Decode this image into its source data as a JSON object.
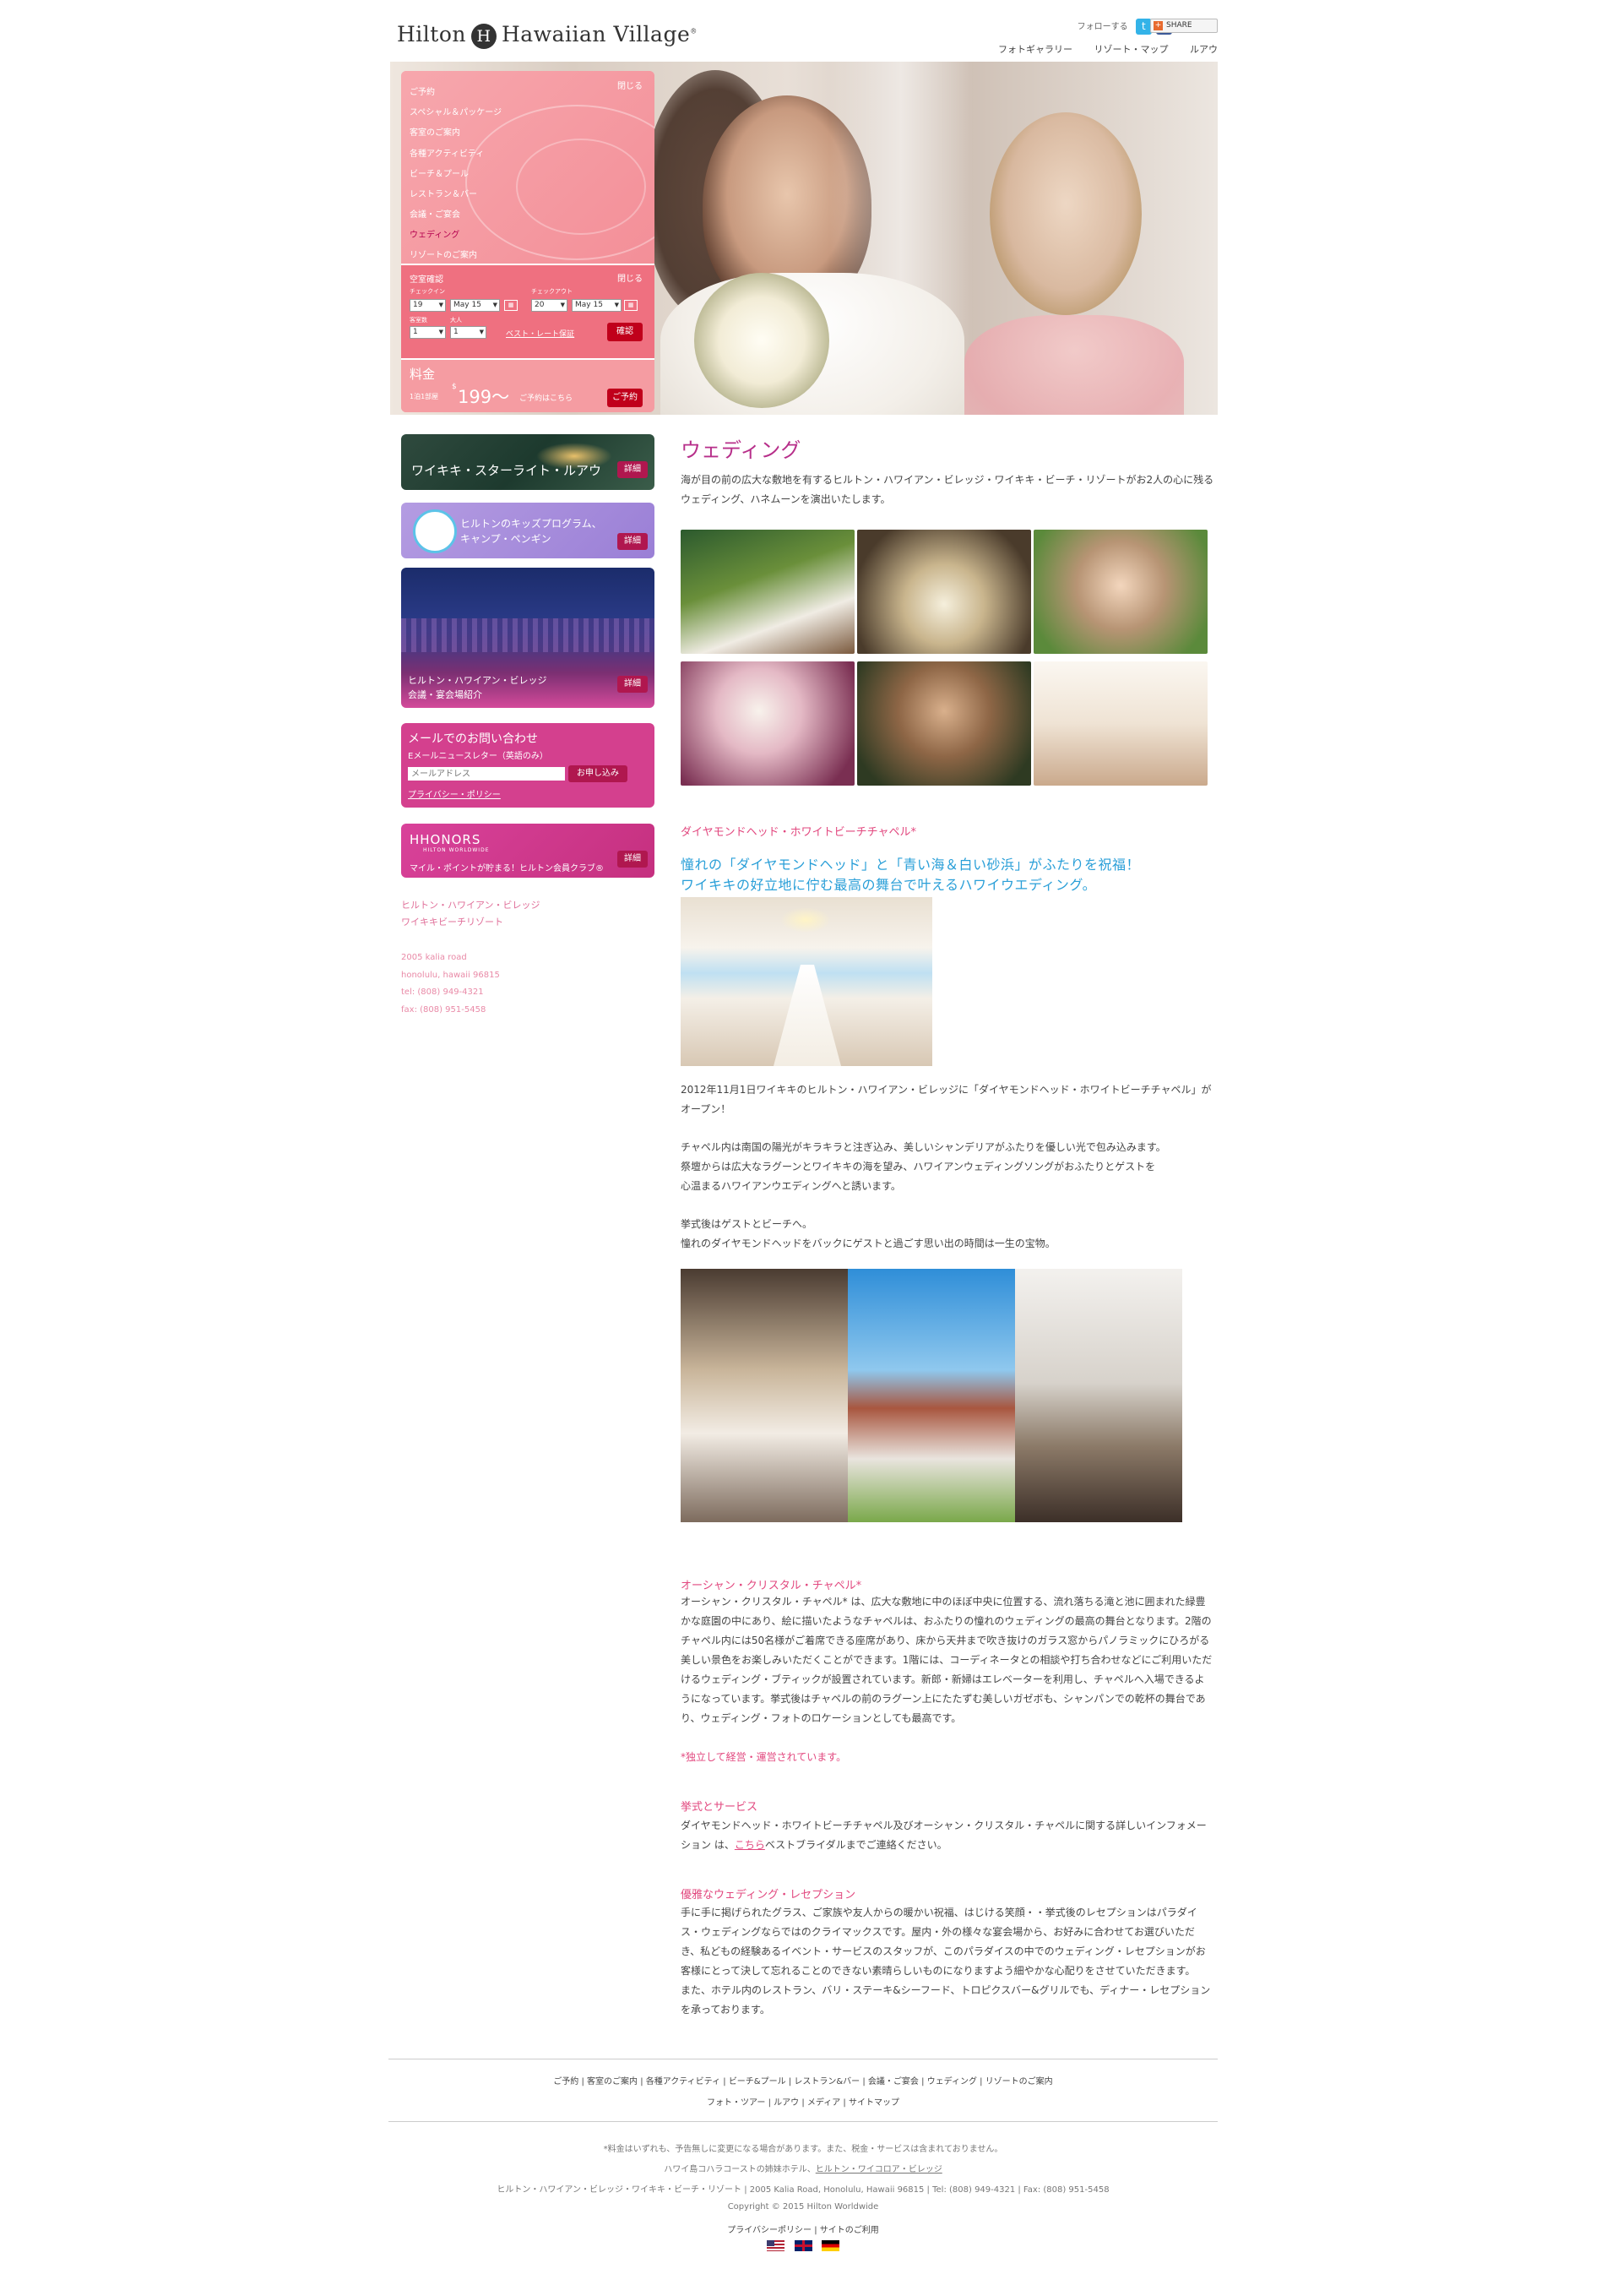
{
  "header": {
    "logo_left": "Hilton",
    "logo_mark": "H",
    "logo_right": "Hawaiian Village",
    "follow_label": "フォローする",
    "twitter_glyph": "t",
    "facebook_glyph": "f",
    "share_label": "SHARE",
    "share_glyph": "+",
    "links": [
      "フォトギャラリー",
      "リゾート・マップ",
      "ルアウ"
    ]
  },
  "booking_menu": {
    "close": "閉じる",
    "items": [
      "ご予約",
      "スペシャル＆パッケージ",
      "客室のご案内",
      "各種アクティビティ",
      "ビーチ＆プール",
      "レストラン＆バー",
      "会議・ご宴会",
      "ウェディング",
      "リゾートのご案内"
    ],
    "active_item": "ウェディング"
  },
  "availability": {
    "title": "空室確認",
    "close": "閉じる",
    "checkin_label": "チェックイン",
    "checkout_label": "チェックアウト",
    "checkin_day": "19",
    "checkin_month": "May 15",
    "checkout_day": "20",
    "checkout_month": "May 15",
    "rooms_label": "客室数",
    "adults_label": "大人",
    "rooms_value": "1",
    "adults_value": "1",
    "best_rate": "ベスト・レート保証",
    "confirm_button": "確認"
  },
  "price_box": {
    "title": "料金",
    "prefix": "1泊1部屋",
    "currency": "$",
    "amount": "199〜",
    "suffix": "ご予約はこちら",
    "book_button": "ご予約"
  },
  "side_banners": {
    "luau": {
      "label": "ワイキキ・スターライト・ルアウ",
      "button": "詳細"
    },
    "kids": {
      "line1": "ヒルトンのキッズプログラム、",
      "line2": "キャンプ・ペンギン",
      "button": "詳細"
    },
    "meetings": {
      "line1": "ヒルトン・ハワイアン・ビレッジ",
      "line2": "会議・宴会場紹介",
      "button": "詳細"
    },
    "newsletter": {
      "title": "メールでのお問い合わせ",
      "subtitle": "Eメールニュースレター（英語のみ）",
      "placeholder": "メールアドレス",
      "button": "お申し込み",
      "privacy": "プライバシー・ポリシー"
    },
    "hhonors": {
      "logo": "HHONORS",
      "logo_sub": "HILTON WORLDWIDE",
      "text": "マイル・ポイントが貯まる！ヒルトン会員クラブ®",
      "button": "詳細"
    }
  },
  "side_info": {
    "name_line1": "ヒルトン・ハワイアン・ビレッジ",
    "name_line2": "ワイキキビーチリゾート",
    "address": [
      "2005 kalia road",
      "honolulu, hawaii 96815",
      "tel: (808) 949-4321",
      "fax: (808) 951-5458"
    ]
  },
  "main": {
    "title": "ウェディング",
    "intro": [
      "海が目の前の広大な敷地を有するヒルトン・ハワイアン・ビレッジ・ワイキキ・ビーチ・リゾートがお2人の心に残る",
      "ウェディング、ハネムーンを演出いたします。"
    ],
    "diamond": {
      "heading": "ダイヤモンドヘッド・ホワイトビーチチャペル*",
      "tagline1": "憧れの「ダイヤモンドヘッド」と「青い海＆白い砂浜」がふたりを祝福！",
      "tagline2": "ワイキキの好立地に佇む最高の舞台で叶えるハワイウエディング。",
      "p1": [
        "2012年11月1日ワイキキのヒルトン・ハワイアン・ビレッジに「ダイヤモンドヘッド・ホワイトビーチチャペル」が",
        "オープン！"
      ],
      "p2": [
        "チャペル内は南国の陽光がキラキラと注ぎ込み、美しいシャンデリアがふたりを優しい光で包み込みます。",
        "祭壇からは広大なラグーンとワイキキの海を望み、ハワイアンウェディングソングがおふたりとゲストを",
        "心温まるハワイアンウエディングへと誘います。"
      ],
      "p3": [
        "挙式後はゲストとビーチへ。",
        "憧れのダイヤモンドヘッドをバックにゲストと過ごす思い出の時間は一生の宝物。"
      ]
    },
    "ocean": {
      "heading": "オーシャン・クリスタル・チャペル*",
      "body": [
        "オーシャン・クリスタル・チャペル* は、広大な敷地に中のほぼ中央に位置する、流れ落ちる滝と池に囲まれた緑豊",
        "かな庭園の中にあり、絵に描いたようなチャペルは、おふたりの憧れのウェディングの最高の舞台となります。2階の",
        "チャペル内には50名様がご着席できる座席があり、床から天井まで吹き抜けのガラス窓からパノラミックにひろがる",
        "美しい景色をお楽しみいただくことができます。1階には、コーディネータとの相談や打ち合わせなどにご利用いただ",
        "けるウェディング・ブティックが設置されています。新郎・新婦はエレベーターを利用し、チャペルへ入場できるよ",
        "うになっています。挙式後はチャペルの前のラグーン上にたたずむ美しいガゼボも、シャンパンでの乾杯の舞台であ",
        "り、ウェディング・フォトのロケーションとしても最高です。"
      ],
      "note": "*独立して経営・運営されています。"
    },
    "services": {
      "heading": "挙式とサービス",
      "line1": "ダイヤモンドヘッド・ホワイトビーチチャペル及びオーシャン・クリスタル・チャペルに関する詳しいインフォメー",
      "line2_pre": "ション は、",
      "line2_link": "こちら",
      "line2_post": "ベストブライダルまでご連絡ください。"
    },
    "reception": {
      "heading": "優雅なウェディング・レセプション",
      "body": [
        "手に手に掲げられたグラス、ご家族や友人からの暖かい祝福、はじける笑顔・・挙式後のレセプションはパラダイ",
        "ス・ウェディングならではのクライマックスです。屋内・外の様々な宴会場から、お好みに合わせてお選びいただ",
        "き、私どもの経験あるイベント・サービスのスタッフが、このパラダイスの中でのウェディング・レセプションがお",
        "客様にとって決して忘れることのできない素晴らしいものになりますよう細やかな心配りをさせていただきます。",
        "また、ホテル内のレストラン、バリ・ステーキ&シーフード、トロピクスバー&グリルでも、ディナー・レセプション",
        "を承っております。"
      ]
    }
  },
  "footer": {
    "nav1": [
      "ご予約",
      "客室のご案内",
      "各種アクティビティ",
      "ビーチ&プール",
      "レストラン&バー",
      "会議・ご宴会",
      "ウェディング",
      "リゾートのご案内"
    ],
    "nav2": [
      "フォト・ツアー",
      "ルアウ",
      "メディア",
      "サイトマップ"
    ],
    "note": "*料金はいずれも、予告無しに変更になる場合があります。また、税金・サービスは含まれておりません。",
    "sister_pre": "ハワイ島コハラコーストの姉妹ホテル、",
    "sister_link": "ヒルトン・ワイコロア・ビレッジ",
    "address": "ヒルトン・ハワイアン・ビレッジ・ワイキキ・ビーチ・リゾート | 2005 Kalia Road, Honolulu, Hawaii 96815 | Tel: (808) 949-4321 | Fax: (808) 951-5458",
    "copyright": "Copyright © 2015 Hilton Worldwide",
    "bottom": [
      "プライバシーポリシー",
      "サイトのご利用"
    ]
  }
}
